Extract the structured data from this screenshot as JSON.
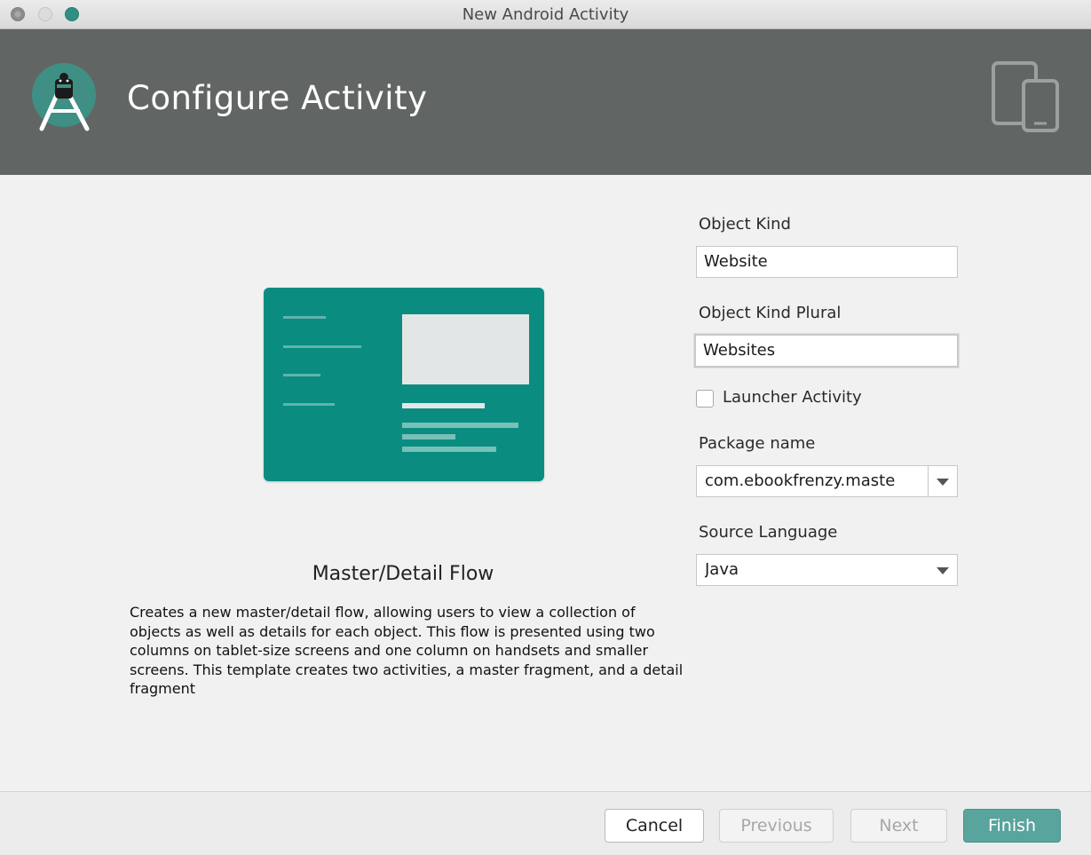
{
  "window": {
    "title": "New Android Activity"
  },
  "header": {
    "title": "Configure Activity"
  },
  "template": {
    "name": "Master/Detail Flow",
    "description": "Creates a new master/detail flow, allowing users to view a collection of objects as well as details for each object. This flow is presented using two columns on tablet-size screens and one column on handsets and smaller screens. This template creates two activities, a master fragment, and a detail fragment"
  },
  "form": {
    "object_kind": {
      "label": "Object Kind",
      "value": "Website"
    },
    "object_kind_plural": {
      "label": "Object Kind Plural",
      "value": "Websites"
    },
    "launcher_activity": {
      "label": "Launcher Activity",
      "checked": false
    },
    "package_name": {
      "label": "Package name",
      "value": "com.ebookfrenzy.maste"
    },
    "source_language": {
      "label": "Source Language",
      "value": "Java"
    }
  },
  "buttons": {
    "cancel": "Cancel",
    "previous": "Previous",
    "next": "Next",
    "finish": "Finish"
  },
  "colors": {
    "header_bg": "#616664",
    "accent_teal": "#0a8d80",
    "finish_button": "#59a49c"
  },
  "icons": [
    "window-close-icon",
    "window-minimize-icon",
    "window-maximize-icon",
    "android-studio-logo-icon",
    "device-phone-tablet-icon",
    "dropdown-arrow-icon"
  ]
}
